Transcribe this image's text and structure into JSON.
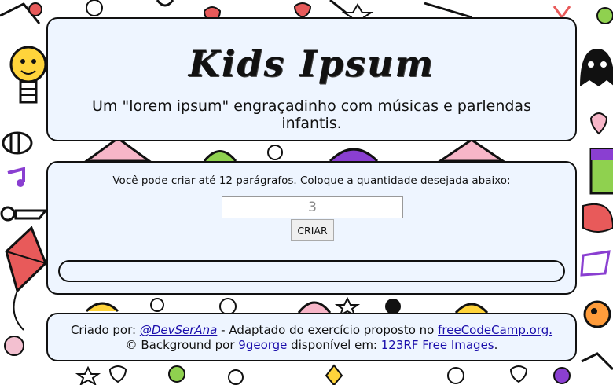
{
  "header": {
    "title": "Kids Ipsum",
    "subtitle": "Um \"lorem ipsum\" engraçadinho com músicas e parlendas infantis."
  },
  "form": {
    "instruction": "Você pode criar até 12 parágrafos. Coloque a quantidade desejada abaixo:",
    "quantity_value": "3",
    "create_label": "CRIAR",
    "output_text": ""
  },
  "footer": {
    "created_by": "Criado por: ",
    "author_link": "@DevSerAna",
    "adapted": " - Adaptado do exercício proposto no ",
    "fcc_link": "freeCodeCamp.org.",
    "bg_prefix": "© Background por ",
    "bg_author_link": "9george",
    "available": " disponível em: ",
    "rf_link": "123RF Free Images",
    "period": "."
  },
  "colors": {
    "card_bg": "#eef5ff",
    "border": "#111111",
    "link": "#1a0dab"
  }
}
